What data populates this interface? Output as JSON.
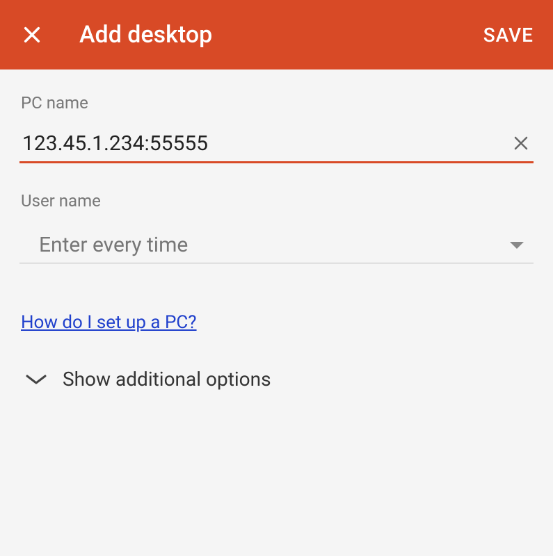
{
  "header": {
    "title": "Add desktop",
    "save_label": "SAVE"
  },
  "pc_name": {
    "label": "PC name",
    "value": "123.45.1.234:55555"
  },
  "user_name": {
    "label": "User name",
    "selected": "Enter every time"
  },
  "help_link_text": "How do I set up a PC?",
  "expand": {
    "label": "Show additional options"
  }
}
